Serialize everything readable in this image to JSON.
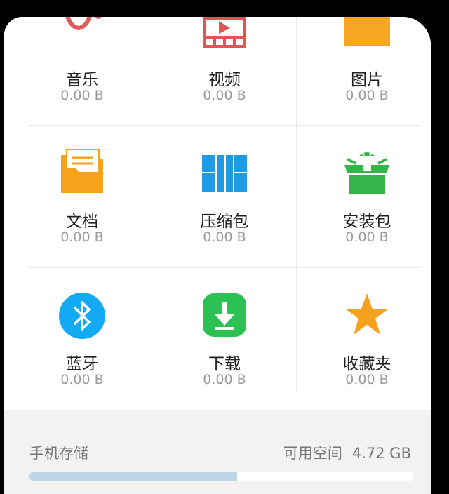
{
  "colors": {
    "music": "#e15a5a",
    "video": "#e05555",
    "image": "#f6a623",
    "document": "#f7a21b",
    "archive": "#1f9be4",
    "apk": "#35b44a",
    "bluetooth": "#14a9f3",
    "download": "#2cc152",
    "favorites": "#f4a21d",
    "progress_fill": "#bcd6e6"
  },
  "categories": [
    {
      "id": "music",
      "label": "音乐",
      "size": "0.00 B",
      "icon": "music-icon"
    },
    {
      "id": "video",
      "label": "视频",
      "size": "0.00 B",
      "icon": "video-icon"
    },
    {
      "id": "image",
      "label": "图片",
      "size": "0.00 B",
      "icon": "image-icon"
    },
    {
      "id": "document",
      "label": "文档",
      "size": "0.00 B",
      "icon": "folder-document-icon"
    },
    {
      "id": "archive",
      "label": "压缩包",
      "size": "0.00 B",
      "icon": "archive-icon"
    },
    {
      "id": "apk",
      "label": "安装包",
      "size": "0.00 B",
      "icon": "android-package-icon"
    },
    {
      "id": "bluetooth",
      "label": "蓝牙",
      "size": "0.00 B",
      "icon": "bluetooth-icon"
    },
    {
      "id": "download",
      "label": "下载",
      "size": "0.00 B",
      "icon": "download-icon"
    },
    {
      "id": "favorites",
      "label": "收藏夹",
      "size": "0.00 B",
      "icon": "star-icon"
    }
  ],
  "storage": {
    "label": "手机存储",
    "free_label": "可用空间",
    "free_value": "4.72 GB",
    "used_fraction": 0.54
  }
}
